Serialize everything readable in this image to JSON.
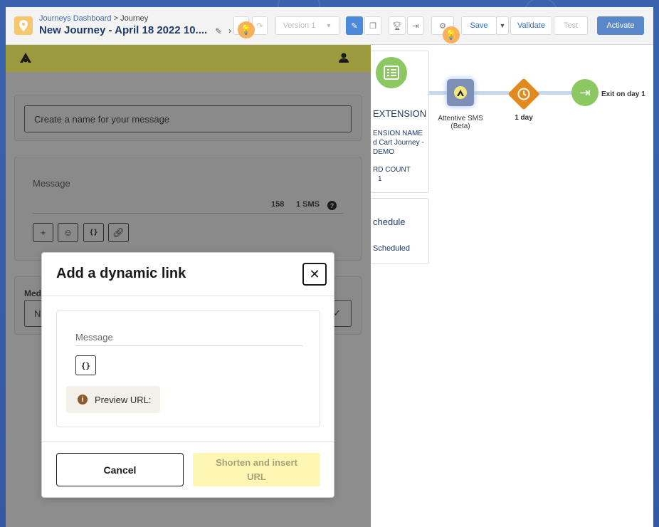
{
  "header": {
    "breadcrumb_link": "Journeys Dashboard",
    "breadcrumb_sep": ">",
    "breadcrumb_current": "Journey",
    "title": "New Journey - April 18 2022 10....",
    "version_label": "Version 1",
    "save_label": "Save",
    "validate_label": "Validate",
    "test_label": "Test",
    "activate_label": "Activate"
  },
  "canvas": {
    "extension_card": {
      "title": "EXTENSION",
      "name_label": "ENSION NAME",
      "name_value_1": "d Cart Journey -",
      "name_value_2": "DEMO",
      "count_label": "RD COUNT",
      "count_value": "1"
    },
    "schedule_card": {
      "title": "chedule",
      "status": "Scheduled"
    },
    "nodes": [
      {
        "label": "Attentive SMS",
        "sublabel": "(Beta)"
      },
      {
        "label": "1 day"
      },
      {
        "label": "Exit on day 1"
      }
    ]
  },
  "panel": {
    "name_placeholder": "Create a name for your message",
    "message_label": "Message",
    "char_count": "158",
    "sms_count": "1 SMS",
    "help": "?",
    "media_label": "Med",
    "media_value": "N"
  },
  "modal": {
    "title": "Add a dynamic link",
    "message_placeholder": "Message",
    "variable_button": "{}",
    "preview_label": "Preview URL:",
    "cancel_label": "Cancel",
    "shorten_label_1": "Shorten and insert",
    "shorten_label_2": "URL"
  },
  "colors": {
    "accent": "#4a8ad8",
    "panel_bar": "#9c9a3e",
    "shorten_bg": "#fdf7b3",
    "green": "#8cc862",
    "orange": "#e38a1f"
  }
}
